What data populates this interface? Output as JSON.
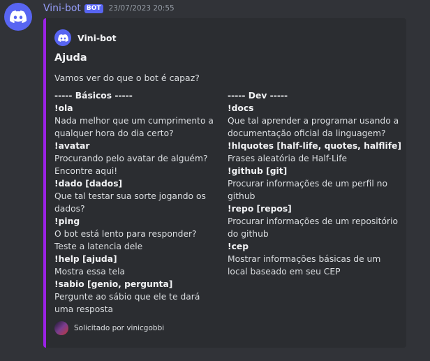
{
  "message": {
    "author": "Vini-bot",
    "bot_tag": "BOT",
    "timestamp": "23/07/2023 20:55"
  },
  "embed": {
    "accent_color": "#9b22e6",
    "author_name": "Vini-bot",
    "title": "Ajuda",
    "description": "Vamos ver do que o bot é capaz?",
    "fields": [
      {
        "name": "----- Básicos -----",
        "commands": [
          {
            "command": "!ola",
            "description": "Nada melhor que um cumprimento a qualquer hora do dia certo?"
          },
          {
            "command": "!avatar",
            "description": "Procurando pelo avatar de alguém? Encontre aqui!"
          },
          {
            "command": "!dado [dados]",
            "description": "Que tal testar sua sorte jogando os dados?"
          },
          {
            "command": "!ping",
            "description": "O bot está lento para responder? Teste a latencia dele"
          },
          {
            "command": "!help [ajuda]",
            "description": "Mostra essa tela"
          },
          {
            "command": "!sabio [genio, pergunta]",
            "description": "Pergunte ao sábio que ele te dará uma resposta"
          }
        ]
      },
      {
        "name": "----- Dev -----",
        "commands": [
          {
            "command": "!docs",
            "description": "Que tal aprender a programar usando a documentação oficial da linguagem?"
          },
          {
            "command": "!hlquotes [half-life, quotes, halflife]",
            "description": "Frases aleatória de Half-Life"
          },
          {
            "command": "!github [git]",
            "description": "Procurar informações de um perfil no github"
          },
          {
            "command": "!repo [repos]",
            "description": "Procurar informações de um repositório do github"
          },
          {
            "command": "!cep",
            "description": "Mostrar informações básicas de um local baseado em seu CEP"
          }
        ]
      }
    ],
    "footer": "Solicitado por vinicgobbi"
  },
  "icons": {
    "bot_avatar": "discord-logo-icon",
    "embed_author": "discord-logo-icon",
    "footer": "user-avatar-icon"
  }
}
